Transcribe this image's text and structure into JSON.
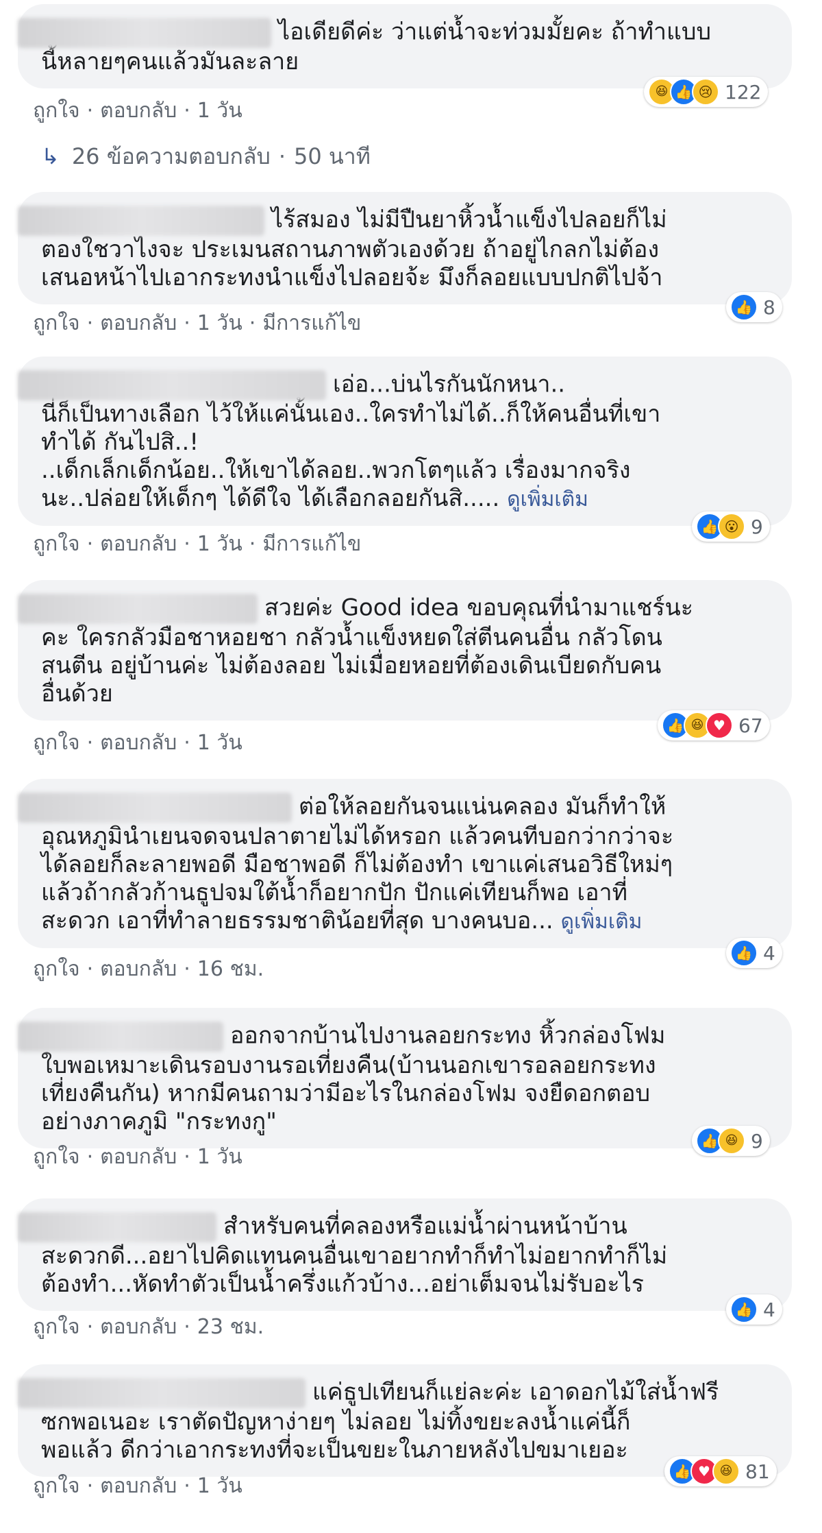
{
  "ui": {
    "like": "ถูกใจ",
    "reply": "ตอบกลับ",
    "dot": "·",
    "see_more": "ดูเพิ่มเติม",
    "edited": "มีการแก้ไข"
  },
  "replies_link": {
    "label": "26 ข้อความตอบกลับ",
    "time": "50 นาที"
  },
  "colors": {
    "bubble": "#f2f3f5",
    "link": "#385898",
    "meta": "#606770",
    "like": "#1877f2",
    "love": "#f0284a",
    "haha": "#f7c12b"
  },
  "comments": [
    {
      "lines": [
        "ไอเดียดีค่ะ ว่าแต่น้ำจะท่วมมั้ยคะ ถ้าทำแบบ",
        "นี้หลายๆคนแล้วมันละลาย"
      ],
      "reactions": [
        "haha-icon",
        "like-icon",
        "sad-icon"
      ],
      "reaction_count": "122",
      "time": "1 วัน"
    },
    {
      "lines": [
        "ไร้สมอง ไม่มีปืนยาหิ้วน้ำแข็งไปลอยก็ไม่",
        "ตองใชวาไงจะ ประเมนสถานภาพตัวเองด้วย ถ้าอยู่ไกลกไม่ต้อง",
        "เสนอหน้าไปเอากระทงนำแข็งไปลอยจ้ะ มึงก็ลอยแบบปกติไปจ้า"
      ],
      "reactions": [
        "like-icon"
      ],
      "reaction_count": "8",
      "time": "1 วัน",
      "edited": true
    },
    {
      "lines": [
        "เอ่อ...บ่นไรกันนักหนา..",
        "นี่ก็เป็นทางเลือก ไว้ให้แค่นั้นเอง..ใครทำไม่ได้..ก็ให้คนอื่นที่เขา",
        "ทำได้ กันไปสิ..!",
        "..เด็กเล็กเด็กน้อย..ให้เขาได้ลอย..พวกโตๆแล้ว เรื่องมากจริง",
        "นะ..ปล่อยให้เด็กๆ ได้ดีใจ ได้เลือกลอยกันสิ....."
      ],
      "reactions": [
        "like-icon",
        "wow-icon"
      ],
      "reaction_count": "9",
      "time": "1 วัน",
      "edited": true,
      "see_more": true
    },
    {
      "lines": [
        "สวยค่ะ Good idea ขอบคุณที่นำมาแชร์นะ",
        "คะ ใครกลัวมือชาหอยชา กลัวน้ำแข็งหยดใส่ตีนคนอื่น กลัวโดน",
        "สนตีน อยู่บ้านค่ะ ไม่ต้องลอย ไม่เมื่อยหอยที่ต้องเดินเบียดกับคน",
        "อื่นด้วย"
      ],
      "reactions": [
        "like-icon",
        "haha-icon",
        "love-icon"
      ],
      "reaction_count": "67",
      "time": "1 วัน"
    },
    {
      "lines": [
        "ต่อให้ลอยกันจนแน่นคลอง มันก็ทำให้",
        "อุณหภูมินำเยนจดจนปลาตายไม่ได้หรอก แล้วคนทีบอกว่ากว่าจะ",
        "ได้ลอยก็ละลายพอดี มือชาพอดี ก็ไม่ต้องทำ เขาแค่เสนอวิธีใหม่ๆ",
        "แล้วถ้ากลัวก้านธูปจมใต้น้ำก็อยากปัก ปักแค่เทียนก็พอ เอาที่",
        "สะดวก เอาที่ทำลายธรรมชาติน้อยที่สุด บางคนบอ..."
      ],
      "reactions": [
        "like-icon"
      ],
      "reaction_count": "4",
      "time": "16 ชม.",
      "see_more": true
    },
    {
      "lines": [
        "ออกจากบ้านไปงานลอยกระทง หิ้วกล่องโฟม",
        "ใบพอเหมาะเดินรอบงานรอเที่ยงคืน(บ้านนอกเขารอลอยกระทง",
        "เที่ยงคืนกัน) หากมีคนถามว่ามีอะไรในกล่องโฟม จงยืดอกตอบ",
        "อย่างภาคภูมิ \"กระทงกู\""
      ],
      "reactions": [
        "like-icon",
        "haha-icon"
      ],
      "reaction_count": "9",
      "time": "1 วัน"
    },
    {
      "lines": [
        "สำหรับคนที่คลองหรือแม่น้ำผ่านหน้าบ้าน",
        "สะดวกดี...อยาไปคิดแทนคนอื่นเขาอยากทำก็ทำไม่อยากทำก็ไม่",
        "ต้องทำ...หัดทำตัวเป็นน้ำครึ่งแก้วบ้าง...อย่าเต็มจนไม่รับอะไร"
      ],
      "reactions": [
        "like-icon"
      ],
      "reaction_count": "4",
      "time": "23 ชม."
    },
    {
      "lines": [
        "แค่ธูปเทียนก็แย่ละค่ะ เอาดอกไม้ใส่น้ำฟรี",
        "ซกพอเนอะ เราตัดปัญหาง่ายๆ ไม่ลอย ไม่ทิ้งขยะลงน้ำแค่นี้ก็",
        "พอแล้ว ดีกว่าเอากระทงที่จะเป็นขยะในภายหลังไปขมาเยอะ"
      ],
      "reactions": [
        "like-icon",
        "love-icon",
        "haha-icon"
      ],
      "reaction_count": "81",
      "time": "1 วัน"
    }
  ]
}
